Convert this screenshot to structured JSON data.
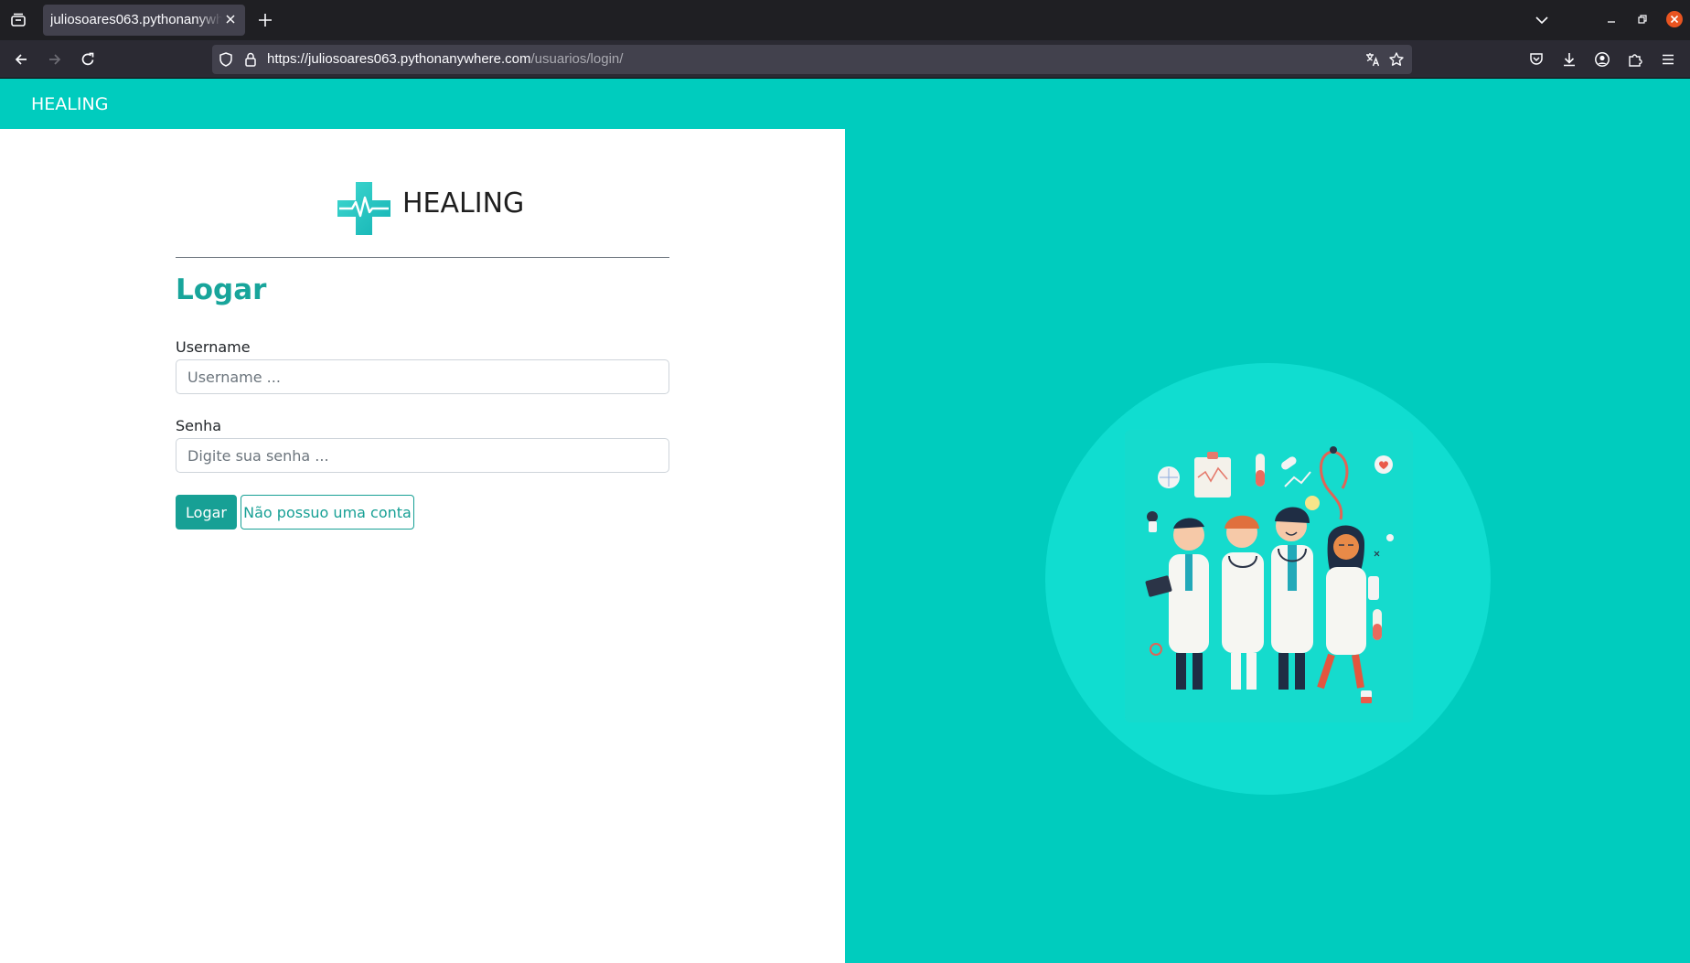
{
  "browser": {
    "tab_title": "juliosoares063.pythonanywhere.com/usuarios/login/",
    "url_host": "https://juliosoares063.pythonanywhere.com",
    "url_path": "/usuarios/login/",
    "icons": [
      "tab-list-icon",
      "close-icon",
      "new-tab-icon",
      "tab-overflow-icon",
      "minimize-icon",
      "restore-icon",
      "window-close-icon",
      "back-icon",
      "forward-icon",
      "reload-icon",
      "shield-icon",
      "lock-icon",
      "translate-icon",
      "bookmark-star-icon",
      "pocket-icon",
      "downloads-icon",
      "account-icon",
      "extensions-icon",
      "menu-icon"
    ]
  },
  "navbar": {
    "brand": "HEALING"
  },
  "logo": {
    "text": "HEALING",
    "icon": "medical-cross-icon"
  },
  "form": {
    "heading": "Logar",
    "username_label": "Username",
    "username_placeholder": "Username ...",
    "password_label": "Senha",
    "password_placeholder": "Digite sua senha ...",
    "submit_label": "Logar",
    "signup_label": "Não possuo uma conta"
  },
  "colors": {
    "accent": "#00ccbe",
    "accent_dark": "#17a095",
    "circle": "#10ddd0"
  },
  "illustration": {
    "icon": "doctors-illustration"
  }
}
